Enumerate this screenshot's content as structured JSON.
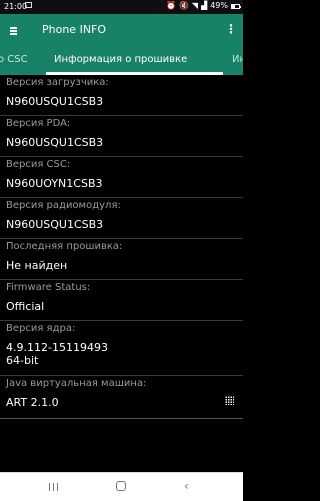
{
  "status_bar": {
    "time": "21:00",
    "battery_text": "49%",
    "battery_level": 0.49,
    "icons": [
      "notification-icon",
      "alarm-icon",
      "mute-icon",
      "wifi-icon",
      "signal-icon",
      "battery-icon"
    ]
  },
  "app_bar": {
    "title": "Phone INFO",
    "menu_icon": "hamburger-menu-icon",
    "more_icon": "more-vertical-icon"
  },
  "tabs": [
    {
      "label": "о CSC",
      "active": false
    },
    {
      "label": "Информация о прошивке",
      "active": true
    },
    {
      "label": "Информ",
      "active": false
    }
  ],
  "info": [
    {
      "label": "Версия загрузчика:",
      "value": "N960USQU1CSB3"
    },
    {
      "label": "Версия PDA:",
      "value": "N960USQU1CSB3"
    },
    {
      "label": "Версия CSC:",
      "value": "N960UOYN1CSB3"
    },
    {
      "label": "Версия радиомодуля:",
      "value": "N960USQU1CSB3"
    },
    {
      "label": "Последняя прошивка:",
      "value": "Не найден"
    },
    {
      "label": "Firmware Status:",
      "value": "Official"
    },
    {
      "label": "Версия ядра:",
      "value": "4.9.112-15119493\n64-bit"
    },
    {
      "label": "Java виртуальная машина:",
      "value": "ART 2.1.0"
    }
  ],
  "colors": {
    "primary": "#188268",
    "background": "#000000",
    "label": "#9a9a9a",
    "value": "#ffffff"
  }
}
